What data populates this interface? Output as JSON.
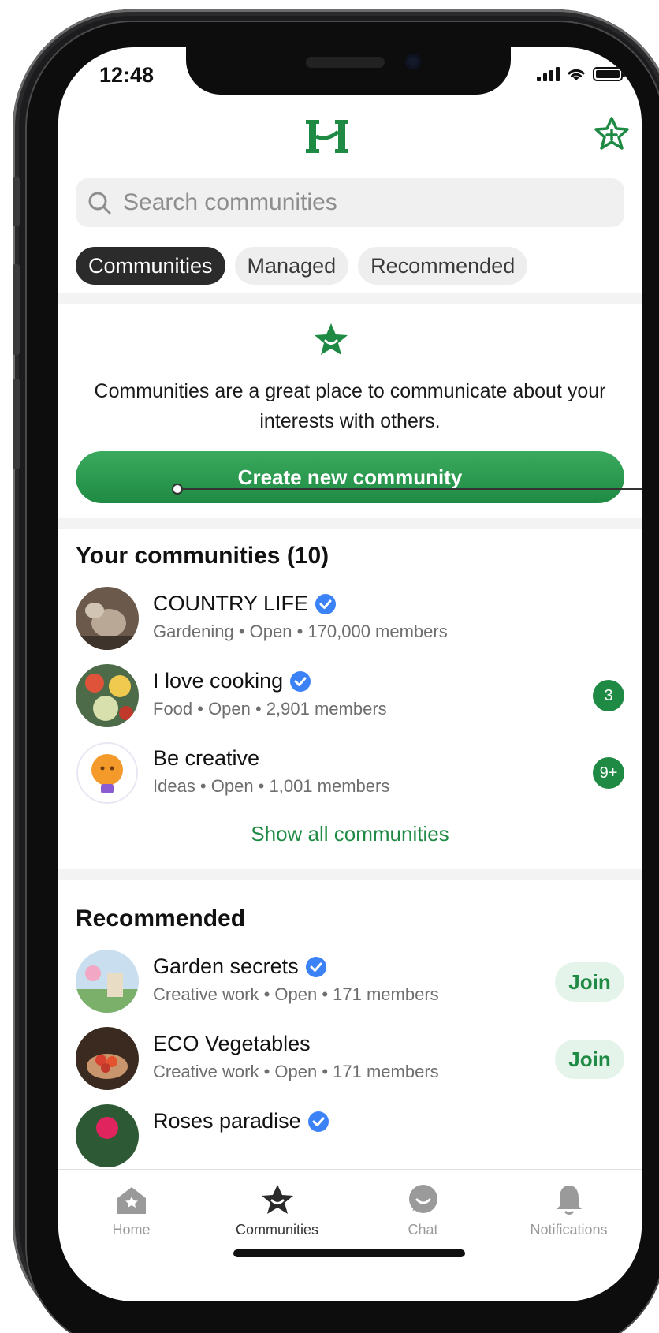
{
  "status": {
    "time": "12:48"
  },
  "search": {
    "placeholder": "Search communities"
  },
  "tabs": [
    {
      "label": "Communities",
      "active": true
    },
    {
      "label": "Managed",
      "active": false
    },
    {
      "label": "Recommended",
      "active": false
    }
  ],
  "info": {
    "text": "Communities are a great place to communicate about your interests with others.",
    "create_label": "Create new community"
  },
  "your_communities": {
    "title": "Your communities (10)",
    "items": [
      {
        "name": "COUNTRY LIFE",
        "meta": "Gardening • Open • 170,000 members",
        "verified": true,
        "badge": ""
      },
      {
        "name": "I love cooking",
        "meta": "Food • Open • 2,901 members",
        "verified": true,
        "badge": "3"
      },
      {
        "name": "Be creative",
        "meta": "Ideas • Open • 1,001 members",
        "verified": false,
        "badge": "9+"
      }
    ],
    "show_all": "Show all communities"
  },
  "recommended": {
    "title": "Recommended",
    "items": [
      {
        "name": "Garden secrets",
        "meta": "Creative work • Open • 171 members",
        "join": "Join"
      },
      {
        "name": "ECO Vegetables",
        "meta": "Creative work • Open • 171 members",
        "join": "Join"
      },
      {
        "name": "Roses paradise",
        "meta": "",
        "join": ""
      }
    ]
  },
  "nav": [
    {
      "label": "Home",
      "icon": "home-icon"
    },
    {
      "label": "Communities",
      "icon": "communities-icon",
      "active": true
    },
    {
      "label": "Chat",
      "icon": "chat-icon"
    },
    {
      "label": "Notifications",
      "icon": "bell-icon"
    }
  ],
  "colors": {
    "brand": "#1f8a43",
    "join_bg": "#e5f4ea",
    "verified": "#3b82f6"
  }
}
